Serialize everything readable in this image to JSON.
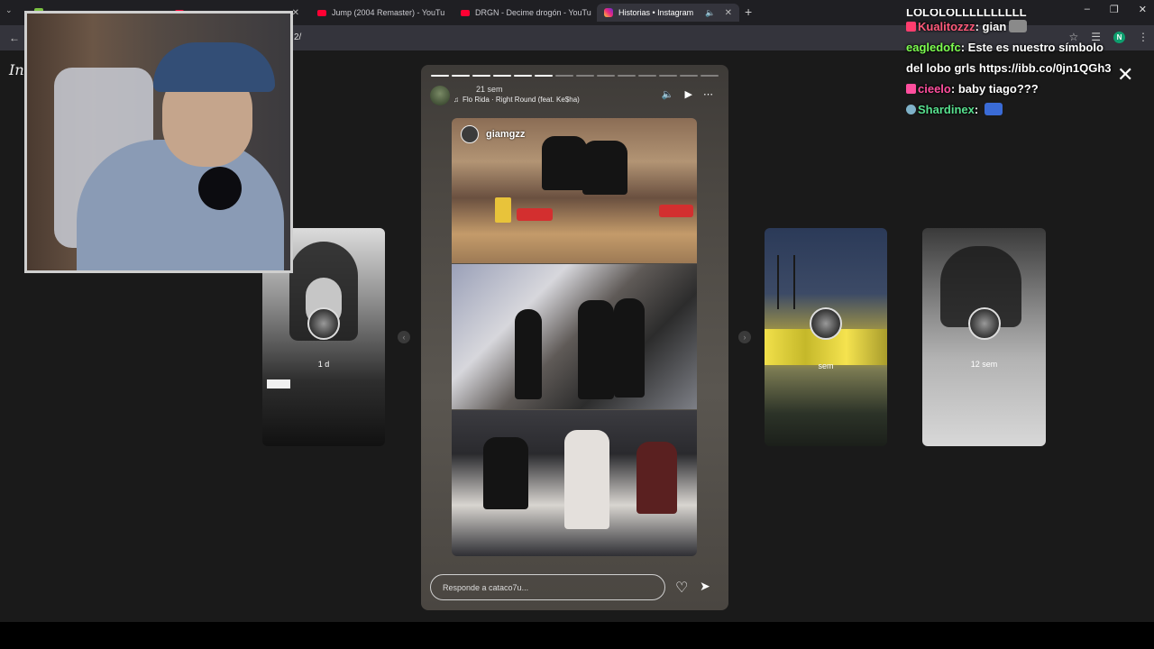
{
  "browser": {
    "tabs": [
      {
        "label": "",
        "icon": "generic",
        "active": false
      },
      {
        "label": "",
        "icon": "generic",
        "active": false
      },
      {
        "label": "Jump (2004 Remaster) - YouTu",
        "icon": "youtube",
        "active": false
      },
      {
        "label": "DRGN - Decime drogón - YouTu",
        "icon": "youtube",
        "active": false
      },
      {
        "label": "Historias • Instagram",
        "icon": "instagram",
        "active": true
      }
    ],
    "url_fragment": "2/",
    "profile_initial": "N"
  },
  "instagram": {
    "logo_text": "In",
    "side_stories": [
      {
        "time": "1 d"
      },
      {
        "time": "sem"
      },
      {
        "time": "12 sem"
      }
    ],
    "story": {
      "time": "21 sem",
      "song": "Flo Rida · Right Round (feat. Ke$ha)",
      "tag_username": "giamgzz",
      "reply_placeholder": "Responde a cataco7u...",
      "progress_total": 14,
      "progress_done": 6
    }
  },
  "chat": {
    "top_line": "LOLOLOLLLLLLLLLL",
    "messages": [
      {
        "user": "Kualitozzz",
        "sep": ":",
        "text": "gian"
      },
      {
        "user": "eagledofc",
        "sep": ":",
        "text": "Este es nuestro símbolo del lobo grls https://ibb.co/0jn1QGh3"
      },
      {
        "user": "cieelo",
        "sep": ":",
        "text": "baby tiago???"
      },
      {
        "user": "Shardinex",
        "sep": ":",
        "text": ""
      }
    ]
  },
  "colors": {
    "accent_youtube": "#ff0033",
    "chat_kualitozzz": "#ff5a7a",
    "chat_eagledofc": "#7dff4f",
    "chat_cieelo": "#ff4f9e",
    "chat_shardinex": "#57e08e"
  }
}
